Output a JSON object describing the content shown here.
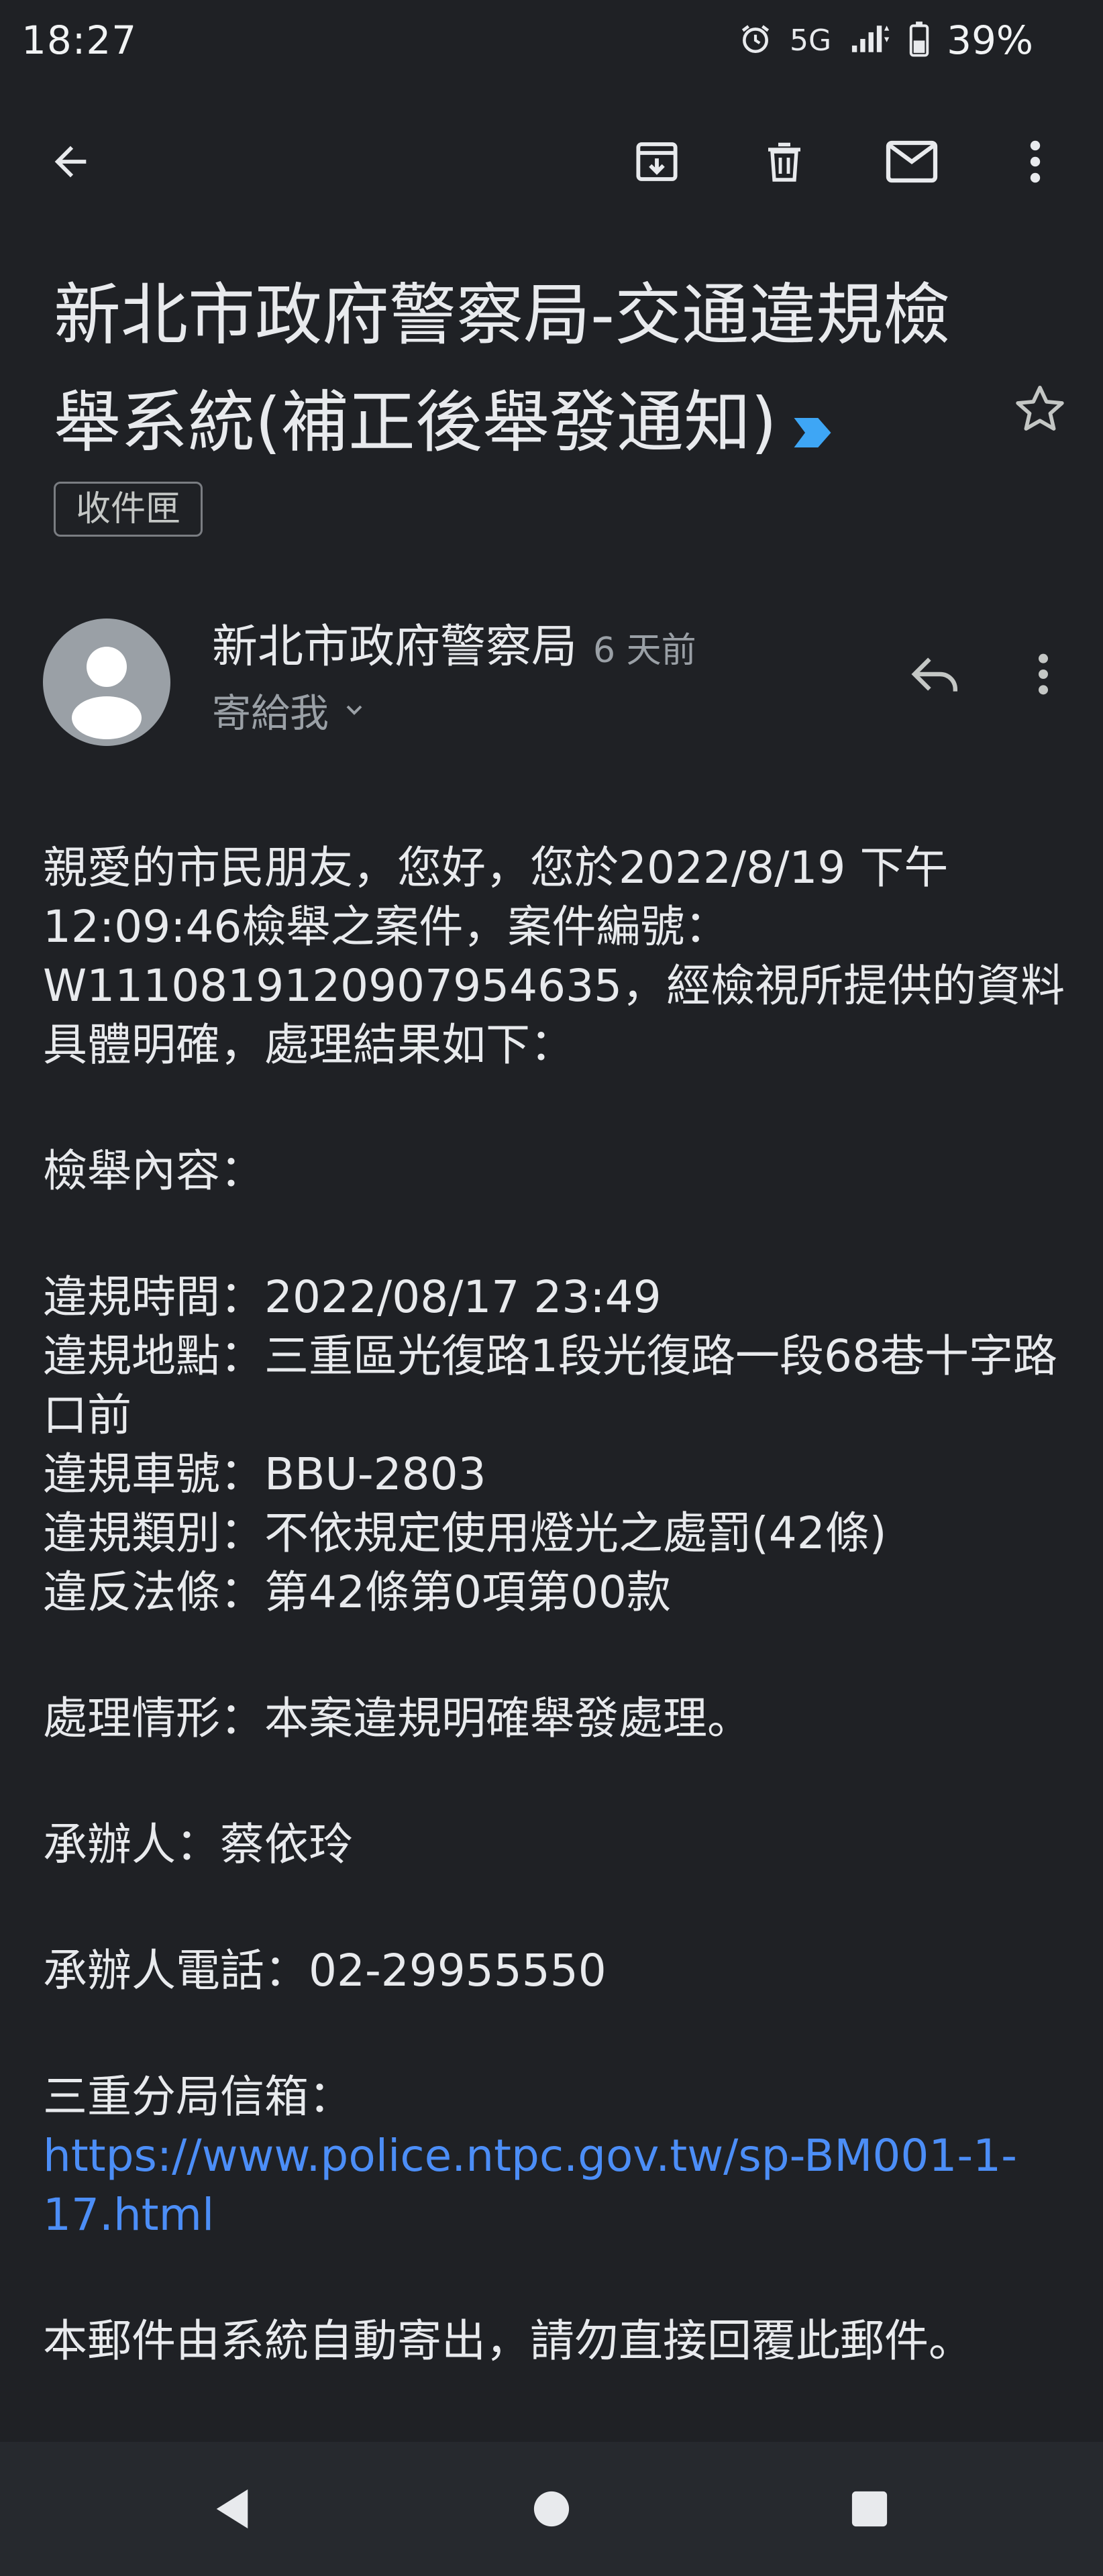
{
  "status_bar": {
    "time": "18:27",
    "network": "5G",
    "battery": "39%",
    "icons": [
      "alarm-icon",
      "signal-icon",
      "battery-icon"
    ]
  },
  "toolbar": {
    "icons": [
      "back-arrow-icon",
      "archive-icon",
      "delete-icon",
      "mark-unread-icon",
      "more-vert-icon"
    ]
  },
  "email": {
    "subject": "新北市政府警察局-交通違規檢舉系統(補正後舉發通知)",
    "label": "收件匣",
    "sender": "新北市政府警察局",
    "time_ago": "6 天前",
    "recipient": "寄給我",
    "body": {
      "intro": "親愛的市民朋友，您好，您於2022/8/19 下午12:09:46檢舉之案件，案件編號：W1110819120907954635，經檢視所提供的資料具體明確，處理結果如下：",
      "report_heading": "檢舉內容：",
      "violation_time": "違規時間：2022/08/17 23:49",
      "violation_place": "違規地點：三重區光復路1段光復路一段68巷十字路口前",
      "plate": "違規車號：BBU-2803",
      "category": "違規類別：不依規定使用燈光之處罰(42條)",
      "law": "違反法條：第42條第0項第00款",
      "result": "處理情形：本案違規明確舉發處理。",
      "handler": "承辦人：蔡依玲",
      "phone": "承辦人電話：02-29955550",
      "mailbox_label": "三重分局信箱：",
      "mailbox_link": "https://www.police.ntpc.gov.tw/sp-BM001-1-17.html",
      "footer": "本郵件由系統自動寄出，請勿直接回覆此郵件。"
    }
  },
  "colors": {
    "background": "#1f2125",
    "link": "#4c8ef7",
    "label_arrow": "#3ea6f5"
  }
}
